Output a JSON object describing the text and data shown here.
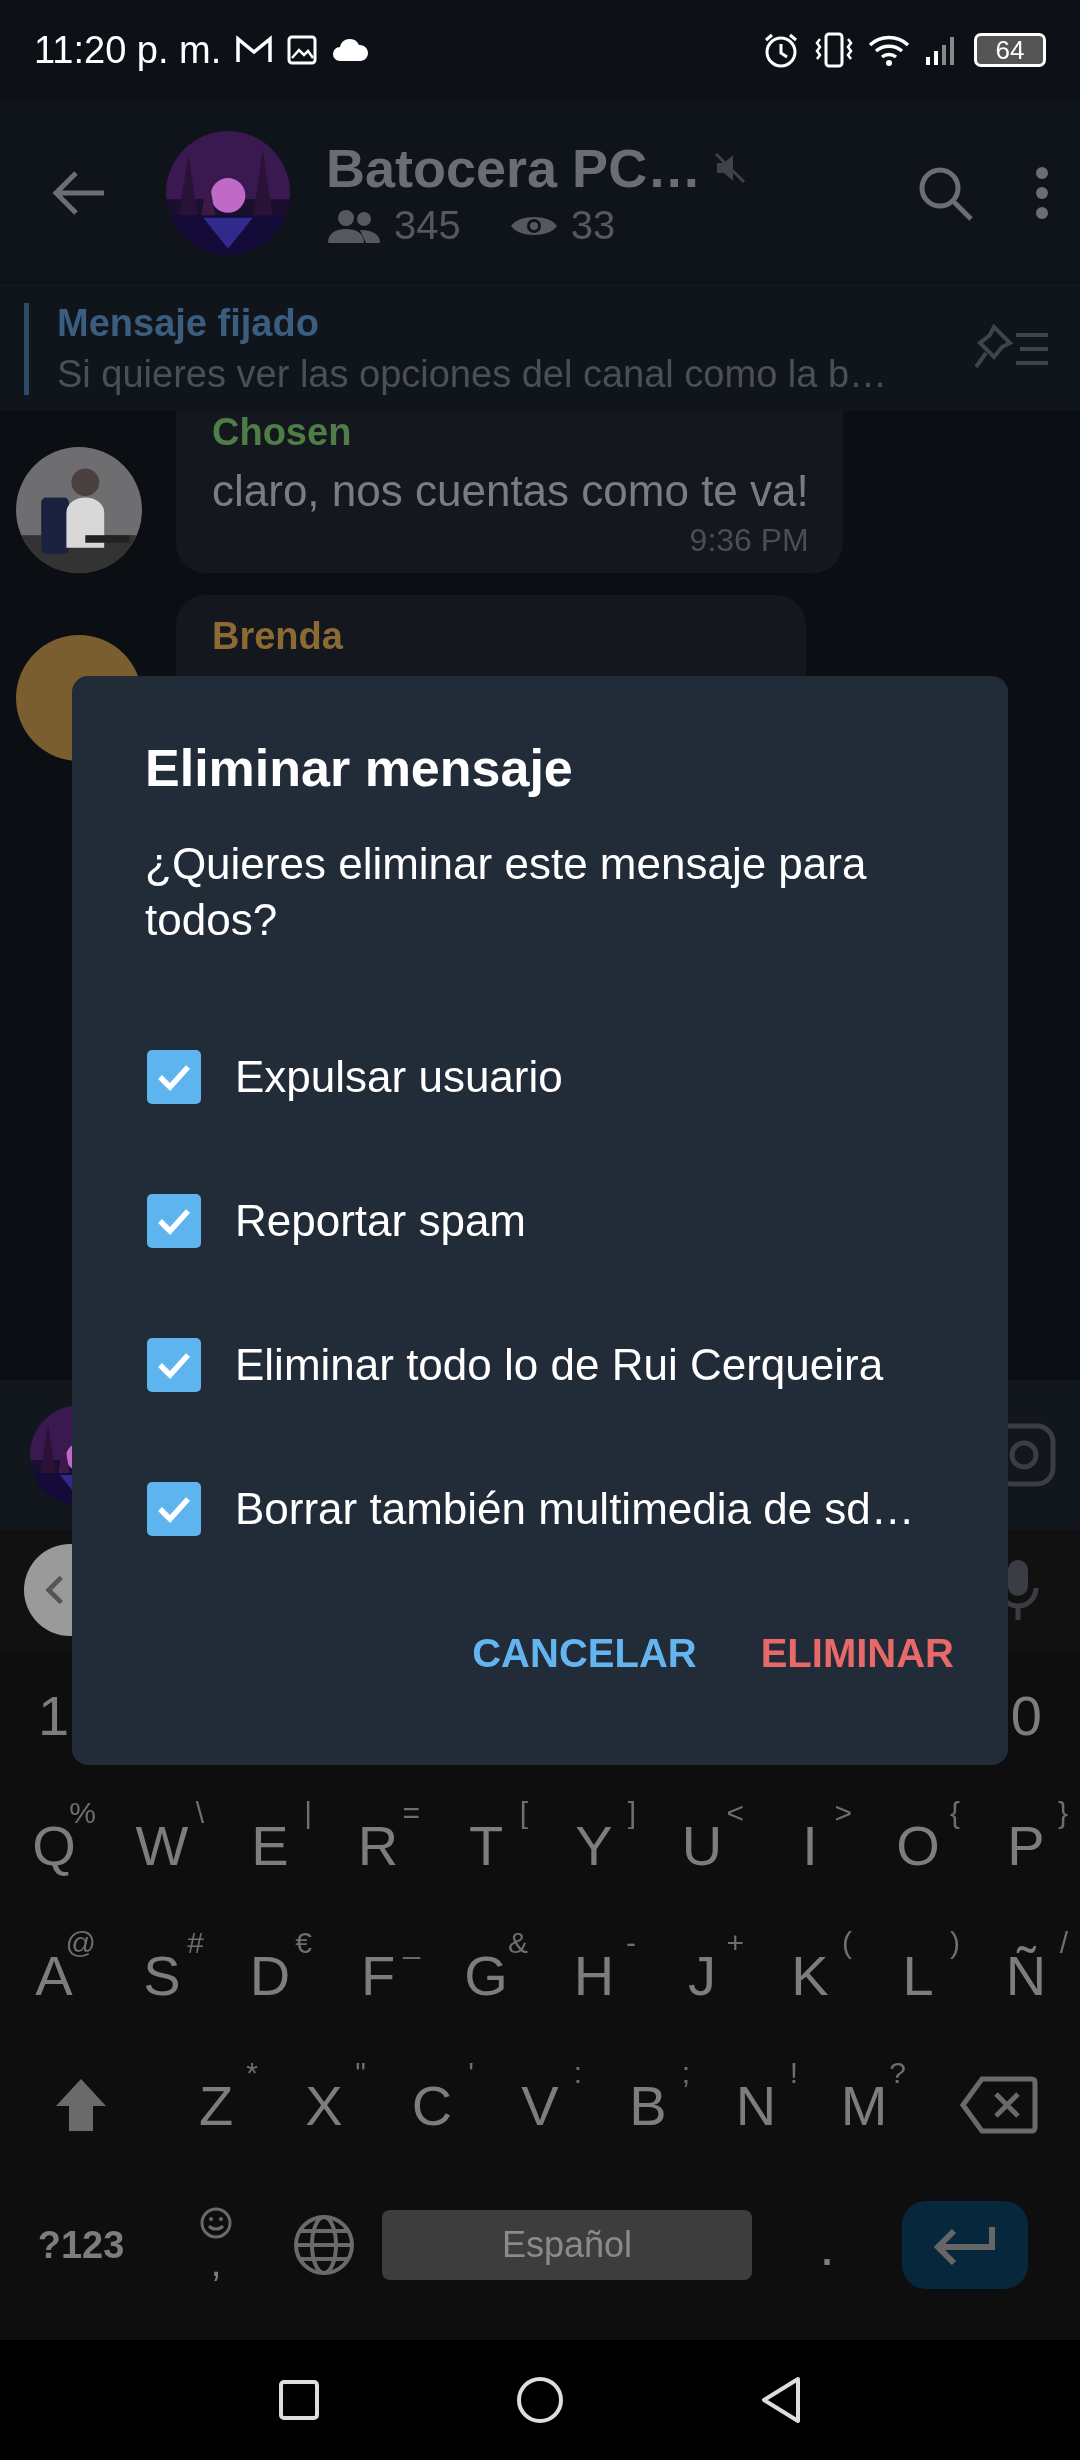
{
  "status_bar": {
    "time": "11:20 p. m.",
    "battery": "64"
  },
  "header": {
    "title": "Batocera PC…",
    "muted": true,
    "members": "345",
    "viewers": "33"
  },
  "pinned": {
    "label": "Mensaje fijado",
    "text": "Si quieres ver las opciones del canal como la b…"
  },
  "messages": [
    {
      "author": "Chosen",
      "color": "#4e7d47",
      "text": "claro, nos cuentas como te va!",
      "time": "9:36 PM",
      "avatar_photo": true
    },
    {
      "author": "Brenda",
      "color": "#8c6a34",
      "avatar_photo": false
    }
  ],
  "dialog": {
    "title": "Eliminar mensaje",
    "body": "¿Quieres eliminar este mensaje para todos?",
    "options": [
      {
        "label": "Expulsar usuario",
        "checked": true
      },
      {
        "label": "Reportar spam",
        "checked": true
      },
      {
        "label": "Eliminar todo lo de Rui Cerqueira",
        "checked": true
      },
      {
        "label": "Borrar también multimedia de sd…",
        "checked": true
      }
    ],
    "buttons": [
      {
        "label": "CANCELAR",
        "kind": "neutral"
      },
      {
        "label": "ELIMINAR",
        "kind": "destructive"
      }
    ]
  },
  "keyboard": {
    "number_row": [
      "1",
      "0"
    ],
    "rows": [
      [
        {
          "key": "Q",
          "hint": "%"
        },
        {
          "key": "W",
          "hint": "\\"
        },
        {
          "key": "E",
          "hint": "|"
        },
        {
          "key": "R",
          "hint": "="
        },
        {
          "key": "T",
          "hint": "["
        },
        {
          "key": "Y",
          "hint": "]"
        },
        {
          "key": "U",
          "hint": "<"
        },
        {
          "key": "I",
          "hint": ">"
        },
        {
          "key": "O",
          "hint": "{"
        },
        {
          "key": "P",
          "hint": "}"
        }
      ],
      [
        {
          "key": "A",
          "hint": "@"
        },
        {
          "key": "S",
          "hint": "#"
        },
        {
          "key": "D",
          "hint": "€"
        },
        {
          "key": "F",
          "hint": "_"
        },
        {
          "key": "G",
          "hint": "&"
        },
        {
          "key": "H",
          "hint": "-"
        },
        {
          "key": "J",
          "hint": "+"
        },
        {
          "key": "K",
          "hint": "("
        },
        {
          "key": "L",
          "hint": ")"
        },
        {
          "key": "Ñ",
          "hint": "/"
        }
      ],
      [
        {
          "key": "Z",
          "hint": "*"
        },
        {
          "key": "X",
          "hint": "\""
        },
        {
          "key": "C",
          "hint": "'"
        },
        {
          "key": "V",
          "hint": ":"
        },
        {
          "key": "B",
          "hint": ";"
        },
        {
          "key": "N",
          "hint": "!"
        },
        {
          "key": "M",
          "hint": "?"
        }
      ]
    ],
    "symbols": "?123",
    "comma": ",",
    "space": "Español",
    "period": "."
  }
}
